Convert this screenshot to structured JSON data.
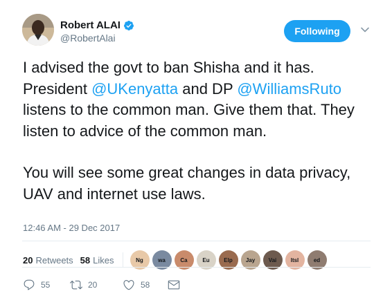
{
  "author": {
    "name": "Robert ALAI",
    "handle": "@RobertAlai",
    "verified": true,
    "avatar_icon": "user-avatar"
  },
  "follow_button": {
    "label": "Following",
    "color": "#1da1f2"
  },
  "tweet": {
    "paragraphs": [
      [
        {
          "text": "I advised the govt to ban Shisha and it has. President "
        },
        {
          "text": "@UKenyatta",
          "mention": true
        },
        {
          "text": " and DP "
        },
        {
          "text": "@WilliamsRuto",
          "mention": true
        },
        {
          "text": " listens to the common man. Give them that. They listen to advice of the common man."
        }
      ],
      [
        {
          "text": "You will see some great changes in data privacy, UAV and internet use laws."
        }
      ]
    ],
    "timestamp": "12:46 AM - 29 Dec 2017"
  },
  "stats": {
    "retweets_count": "20",
    "retweets_label": "Retweets",
    "likes_count": "58",
    "likes_label": "Likes",
    "likers": [
      {
        "label": "Ng",
        "color": "#e8c9a8"
      },
      {
        "label": "wa",
        "color": "#7a8aa0"
      },
      {
        "label": "Ca",
        "color": "#c98b6b"
      },
      {
        "label": "Eu",
        "color": "#d9d3c7"
      },
      {
        "label": "Elp",
        "color": "#9a6b4f"
      },
      {
        "label": "Jay",
        "color": "#b9a58f"
      },
      {
        "label": "Vai",
        "color": "#6d5a4e"
      },
      {
        "label": "Itsl",
        "color": "#e3b4a0"
      },
      {
        "label": "ed",
        "color": "#8f7c70"
      }
    ]
  },
  "actions": {
    "reply_count": "55",
    "retweet_count": "20",
    "like_count": "58"
  },
  "colors": {
    "accent": "#1da1f2",
    "text": "#14171a",
    "secondary": "#657786",
    "divider": "#e6ecf0"
  }
}
